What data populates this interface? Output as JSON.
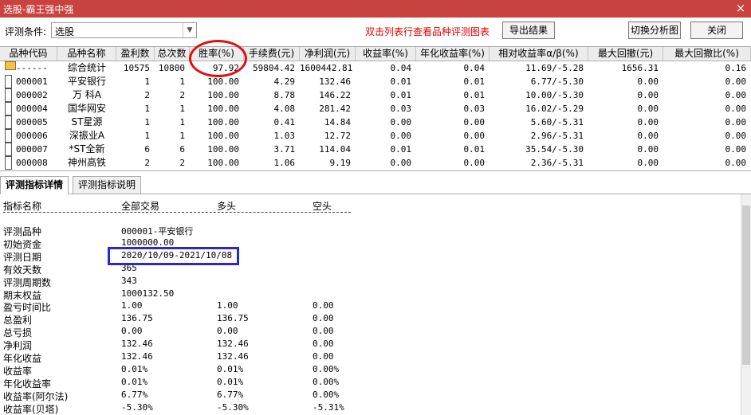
{
  "window": {
    "title": "选股-霸王强中强",
    "close_glyph": "×"
  },
  "toolbar": {
    "condition_label": "评测条件:",
    "condition_value": "选股",
    "hint": "双击列表行查看品种评测图表",
    "export_label": "导出结果",
    "switch_label": "切换分析图",
    "close_label": "关闭"
  },
  "grid": {
    "columns": [
      "品种代码",
      "品种名称",
      "盈利数",
      "总次数",
      "胜率(%)",
      "手续费(元)",
      "净利润(元)",
      "收益率(%)",
      "年化收益率(%)",
      "相对收益率α/β(%)",
      "最大回撤(元)",
      "最大回撤比(%)"
    ],
    "rows": [
      [
        "------",
        "综合统计",
        "10575",
        "10800",
        "97.92",
        "59804.42",
        "1600442.81",
        "0.04",
        "0.04",
        "11.69/-5.28",
        "1656.31",
        "0.16"
      ],
      [
        "000001",
        "平安银行",
        "1",
        "1",
        "100.00",
        "4.29",
        "132.46",
        "0.01",
        "0.01",
        "6.77/-5.30",
        "0.00",
        "0.00"
      ],
      [
        "000002",
        "万 科A",
        "2",
        "2",
        "100.00",
        "8.78",
        "146.22",
        "0.01",
        "0.01",
        "10.00/-5.30",
        "0.00",
        "0.00"
      ],
      [
        "000004",
        "国华网安",
        "1",
        "1",
        "100.00",
        "4.08",
        "281.42",
        "0.03",
        "0.03",
        "16.02/-5.29",
        "0.00",
        "0.00"
      ],
      [
        "000005",
        "ST星源",
        "1",
        "1",
        "100.00",
        "0.41",
        "14.84",
        "0.00",
        "0.00",
        "5.60/-5.31",
        "0.00",
        "0.00"
      ],
      [
        "000006",
        "深振业A",
        "1",
        "1",
        "100.00",
        "1.03",
        "12.72",
        "0.00",
        "0.00",
        "2.96/-5.31",
        "0.00",
        "0.00"
      ],
      [
        "000007",
        "*ST全新",
        "6",
        "6",
        "100.00",
        "3.71",
        "114.04",
        "0.01",
        "0.01",
        "35.54/-5.30",
        "0.00",
        "0.00"
      ],
      [
        "000008",
        "神州高铁",
        "2",
        "2",
        "100.00",
        "1.06",
        "9.19",
        "0.00",
        "0.00",
        "2.36/-5.31",
        "0.00",
        "0.00"
      ]
    ]
  },
  "tabs": [
    "评测指标详情",
    "评测指标说明"
  ],
  "detail": {
    "headers": [
      "指标名称",
      "全部交易",
      "多头",
      "空头"
    ],
    "rows": [
      [
        "评测品种",
        "000001-平安银行",
        "",
        ""
      ],
      [
        "初始资金",
        "1000000.00",
        "",
        ""
      ],
      [
        "评测日期",
        "2020/10/09-2021/10/08",
        "",
        ""
      ],
      [
        "有效天数",
        "365",
        "",
        ""
      ],
      [
        "评测周期数",
        "343",
        "",
        ""
      ],
      [
        "期末权益",
        "1000132.50",
        "",
        ""
      ],
      [
        "盈亏时间比",
        "1.00",
        "1.00",
        "0.00"
      ],
      [
        "总盈利",
        "136.75",
        "136.75",
        "0.00"
      ],
      [
        "总亏损",
        "0.00",
        "0.00",
        "0.00"
      ],
      [
        "净利润",
        "132.46",
        "132.46",
        "0.00"
      ],
      [
        "年化收益",
        "132.46",
        "132.46",
        "0.00"
      ],
      [
        "收益率",
        "0.01%",
        "0.01%",
        "0.00%"
      ],
      [
        "年化收益率",
        "0.01%",
        "0.01%",
        "0.00%"
      ],
      [
        "收益率(阿尔法)",
        "6.77%",
        "6.77%",
        "0.00%"
      ],
      [
        "收益率(贝塔)",
        "-5.30%",
        "-5.30%",
        "-5.31%"
      ]
    ]
  },
  "colors": {
    "titlebar": "#c9423e",
    "hint": "#e00000",
    "highlight_circle": "#e01010",
    "highlight_rect": "#2a2acc"
  }
}
